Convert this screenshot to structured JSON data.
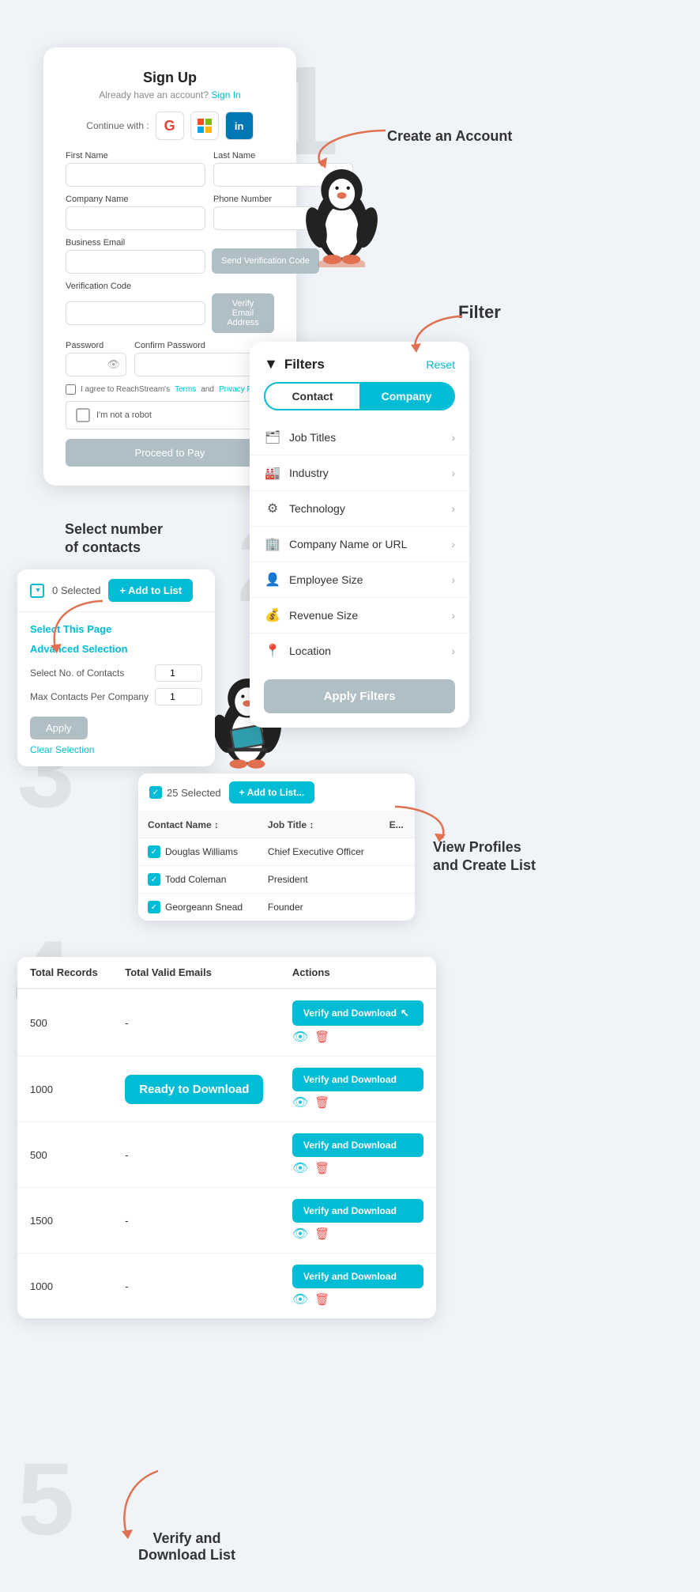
{
  "page": {
    "bg_color": "#f0f4f8"
  },
  "signup": {
    "title": "Sign Up",
    "subtitle": "Already have an account?",
    "signin_link": "Sign In",
    "continue_label": "Continue with :",
    "social": [
      "G",
      "⊞",
      "in"
    ],
    "fields": {
      "first_name": "First Name",
      "last_name": "Last Name",
      "company_name": "Company Name",
      "phone_number": "Phone Number",
      "business_email": "Business Email",
      "verification_code": "Verification Code",
      "password": "Password",
      "confirm_password": "Confirm Password"
    },
    "btn_send": "Send Verification Code",
    "btn_verify": "Verify Email Address",
    "agree_text": "I agree to ReachStream's",
    "terms": "Terms",
    "and": "and",
    "privacy": "Privacy Policy",
    "recaptcha_text": "I'm not a robot",
    "btn_proceed": "Proceed to Pay"
  },
  "labels": {
    "create_account": "Create an Account",
    "filter": "Filter",
    "select_contacts": "Select number\nof contacts",
    "view_profiles": "View Profiles\nand Create List",
    "verify_download": "Verify and\nDownload List"
  },
  "filters": {
    "title": "Filters",
    "reset": "Reset",
    "tab_contact": "Contact",
    "tab_company": "Company",
    "items": [
      {
        "icon": "🗂",
        "label": "Job Titles"
      },
      {
        "icon": "🏭",
        "label": "Industry"
      },
      {
        "icon": "⚙",
        "label": "Technology"
      },
      {
        "icon": "🏢",
        "label": "Company Name or URL"
      },
      {
        "icon": "👤",
        "label": "Employee Size"
      },
      {
        "icon": "💰",
        "label": "Revenue Size"
      },
      {
        "icon": "📍",
        "label": "Location"
      }
    ],
    "apply_btn": "Apply Filters"
  },
  "contact_select": {
    "selected_count": "0 Selected",
    "add_to_list": "+ Add to List",
    "select_this_page": "Select This Page",
    "advanced_selection": "Advanced Selection",
    "select_no_label": "Select No. of Contacts",
    "max_per_company_label": "Max Contacts Per Company",
    "apply_btn": "Apply",
    "clear_btn": "Clear Selection",
    "input_val1": "1",
    "input_val2": "1"
  },
  "contacts_table": {
    "selected_count": "25 Selected",
    "add_to_list": "+ Add to List...",
    "columns": [
      "Contact Name ↕",
      "Job Title ↕",
      "E..."
    ],
    "rows": [
      {
        "checked": true,
        "name": "Douglas Williams",
        "job_title": "Chief Executive Officer"
      },
      {
        "checked": true,
        "name": "Todd Coleman",
        "job_title": "President"
      },
      {
        "checked": true,
        "name": "Georgeann Snead",
        "job_title": "Founder"
      }
    ]
  },
  "download_table": {
    "columns": [
      "Total Records",
      "Total Valid Emails",
      "Actions"
    ],
    "rows": [
      {
        "total": "500",
        "valid": "-",
        "action": "Verify and Download",
        "ready": false
      },
      {
        "total": "1000",
        "valid": "-",
        "action": "Verify and Download",
        "ready": true
      },
      {
        "total": "500",
        "valid": "-",
        "action": "Verify and Download",
        "ready": false
      },
      {
        "total": "1500",
        "valid": "-",
        "action": "Verify and Download",
        "ready": false
      },
      {
        "total": "1000",
        "valid": "-",
        "action": "Verify and Download",
        "ready": false
      }
    ],
    "ready_label": "Ready to Download"
  }
}
